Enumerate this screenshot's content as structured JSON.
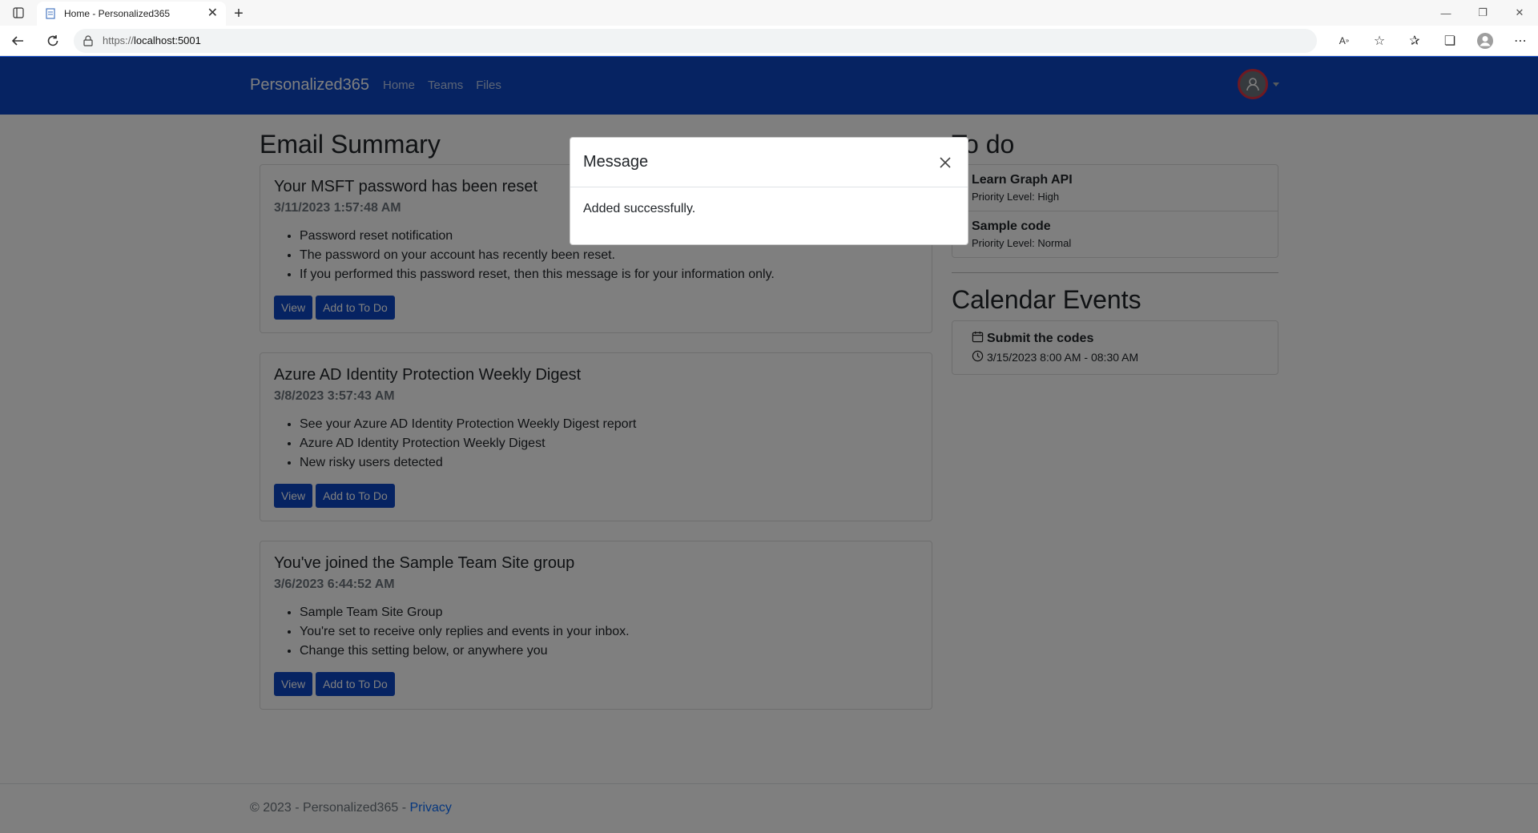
{
  "browser": {
    "tab_title": "Home - Personalized365",
    "url_prefix": "https://",
    "url_host": "localhost:5001"
  },
  "nav": {
    "brand": "Personalized365",
    "links": [
      "Home",
      "Teams",
      "Files"
    ]
  },
  "email": {
    "heading": "Email Summary",
    "items": [
      {
        "subject": "Your MSFT password has been reset",
        "date": "3/11/2023 1:57:48 AM",
        "bullets": [
          "Password reset notification",
          "The password on your account has recently been reset.",
          "If you performed this password reset, then this message is for your information only."
        ],
        "view_label": "View",
        "add_label": "Add to To Do"
      },
      {
        "subject": "Azure AD Identity Protection Weekly Digest",
        "date": "3/8/2023 3:57:43 AM",
        "bullets": [
          "See your Azure AD Identity Protection Weekly Digest report",
          "Azure AD Identity Protection Weekly Digest",
          "New risky users detected"
        ],
        "view_label": "View",
        "add_label": "Add to To Do"
      },
      {
        "subject": "You've joined the Sample Team Site group",
        "date": "3/6/2023 6:44:52 AM",
        "bullets": [
          "Sample Team Site Group",
          "You're set to receive only replies and events in your inbox.",
          "Change this setting below, or anywhere you"
        ],
        "view_label": "View",
        "add_label": "Add to To Do"
      }
    ]
  },
  "todo": {
    "heading": "To do",
    "items": [
      {
        "title": "Learn Graph API",
        "priority": "Priority Level: High"
      },
      {
        "title": "Sample code",
        "priority": "Priority Level: Normal"
      }
    ]
  },
  "calendar": {
    "heading": "Calendar Events",
    "events": [
      {
        "title": "Submit the codes",
        "time": "3/15/2023 8:00 AM - 08:30 AM"
      }
    ]
  },
  "footer": {
    "text": "© 2023 - Personalized365 - ",
    "privacy": "Privacy"
  },
  "modal": {
    "title": "Message",
    "body": "Added successfully."
  }
}
